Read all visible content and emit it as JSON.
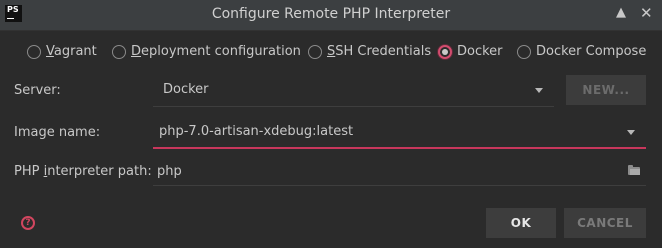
{
  "window": {
    "app_icon_text": "PS",
    "title": "Configure Remote PHP Interpreter",
    "minimize_glyph": "▲",
    "close_glyph": "✕"
  },
  "radios": [
    {
      "label_pre": "",
      "mnemonic": "V",
      "label_post": "agrant",
      "checked": false
    },
    {
      "label_pre": "",
      "mnemonic": "D",
      "label_post": "eployment configuration",
      "checked": false
    },
    {
      "label_pre": "",
      "mnemonic": "S",
      "label_post": "SH Credentials",
      "checked": false
    },
    {
      "label_pre": "Docker",
      "mnemonic": "",
      "label_post": "",
      "checked": true
    },
    {
      "label_pre": "Docker Compose",
      "mnemonic": "",
      "label_post": "",
      "checked": false
    }
  ],
  "server": {
    "label": "Server:",
    "value": "Docker",
    "new_button": "NEW..."
  },
  "image": {
    "label": "Image name:",
    "value": "php-7.0-artisan-xdebug:latest"
  },
  "php_path": {
    "label_pre": "PHP ",
    "mnemonic": "i",
    "label_post": "nterpreter path:",
    "value": "php"
  },
  "buttons": {
    "help": "?",
    "ok": "OK",
    "cancel": "CANCEL"
  },
  "colors": {
    "accent": "#c8375c",
    "background": "#2b2b2b",
    "titlebar": "#3c3f41"
  },
  "icons": [
    "app-icon",
    "minimize-icon",
    "close-icon",
    "chevron-down-icon",
    "folder-icon",
    "help-icon"
  ]
}
